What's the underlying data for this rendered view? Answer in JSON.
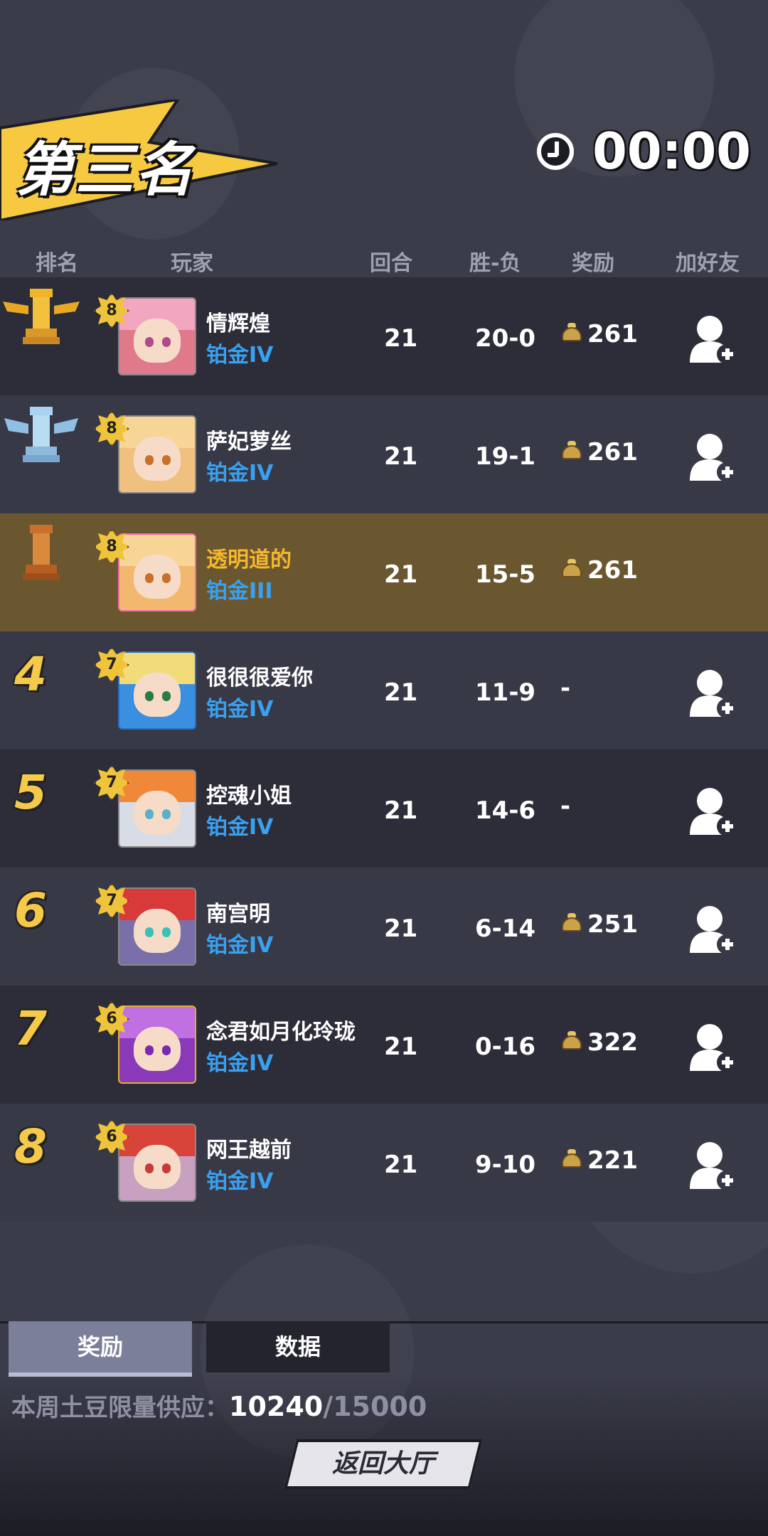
{
  "header": {
    "placement_title": "第三名",
    "timer": "00:00"
  },
  "columns": {
    "rank": "排名",
    "player": "玩家",
    "rounds": "回合",
    "win_loss": "胜-负",
    "reward": "奖励",
    "add_friend": "加好友"
  },
  "players": [
    {
      "rank": "1",
      "level": "8",
      "name": "情辉煌",
      "tier": "铂金IV",
      "rounds": "21",
      "wl": "20-0",
      "reward": "261",
      "friendable": true
    },
    {
      "rank": "2",
      "level": "8",
      "name": "萨妃萝丝",
      "tier": "铂金IV",
      "rounds": "21",
      "wl": "19-1",
      "reward": "261",
      "friendable": true
    },
    {
      "rank": "3",
      "level": "8",
      "name": "透明道的",
      "tier": "铂金III",
      "rounds": "21",
      "wl": "15-5",
      "reward": "261",
      "friendable": false,
      "is_self": true
    },
    {
      "rank": "4",
      "level": "7",
      "name": "很很很爱你",
      "tier": "铂金IV",
      "rounds": "21",
      "wl": "11-9",
      "reward": "-",
      "friendable": true
    },
    {
      "rank": "5",
      "level": "7",
      "name": "控魂小姐",
      "tier": "铂金IV",
      "rounds": "21",
      "wl": "14-6",
      "reward": "-",
      "friendable": true
    },
    {
      "rank": "6",
      "level": "7",
      "name": "南宫明",
      "tier": "铂金IV",
      "rounds": "21",
      "wl": "6-14",
      "reward": "251",
      "friendable": true
    },
    {
      "rank": "7",
      "level": "6",
      "name": "念君如月化玲珑",
      "tier": "铂金IV",
      "rounds": "21",
      "wl": "0-16",
      "reward": "322",
      "friendable": true
    },
    {
      "rank": "8",
      "level": "6",
      "name": "网王越前",
      "tier": "铂金IV",
      "rounds": "21",
      "wl": "9-10",
      "reward": "221",
      "friendable": true
    }
  ],
  "tabs": {
    "reward": "奖励",
    "data": "数据"
  },
  "supply": {
    "label": "本周土豆限量供应：",
    "current": "10240",
    "max": "/15000"
  },
  "return_button": "返回大厅",
  "colors": {
    "gold": "#f5c94a",
    "tier_blue": "#3aa0f0",
    "self_row": "#6a5730",
    "self_name": "#f5b72e"
  }
}
